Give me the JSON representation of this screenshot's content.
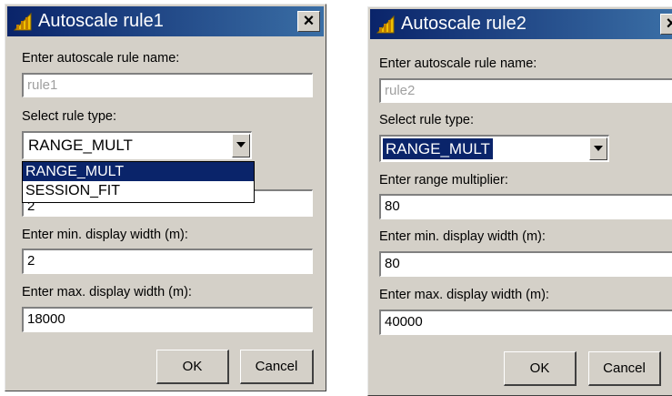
{
  "dialog1": {
    "title": "Autoscale rule1",
    "close_glyph": "×",
    "name_label": "Enter autoscale rule name:",
    "name_value": "rule1",
    "type_label": "Select rule type:",
    "type_value": "RANGE_MULT",
    "type_options": [
      "RANGE_MULT",
      "SESSION_FIT"
    ],
    "range_value_partial": "2",
    "min_label": "Enter min. display width (m):",
    "min_value": "2",
    "max_label": "Enter max. display width (m):",
    "max_value": "18000",
    "ok_label": "OK",
    "cancel_label": "Cancel"
  },
  "dialog2": {
    "title": "Autoscale rule2",
    "close_glyph": "×",
    "name_label": "Enter autoscale rule name:",
    "name_value": "rule2",
    "type_label": "Select rule type:",
    "type_value": "RANGE_MULT",
    "range_label": "Enter range multiplier:",
    "range_value": "80",
    "min_label": "Enter min. display width (m):",
    "min_value": "80",
    "max_label": "Enter max. display width (m):",
    "max_value": "40000",
    "ok_label": "OK",
    "cancel_label": "Cancel"
  },
  "colors": {
    "titlebar": "#0a246a",
    "dialog_bg": "#d4d0c8",
    "selection": "#0a246a"
  },
  "icons": {
    "title_icon": "chart-icon",
    "close": "close-icon",
    "combo_arrow": "chevron-down-icon"
  }
}
